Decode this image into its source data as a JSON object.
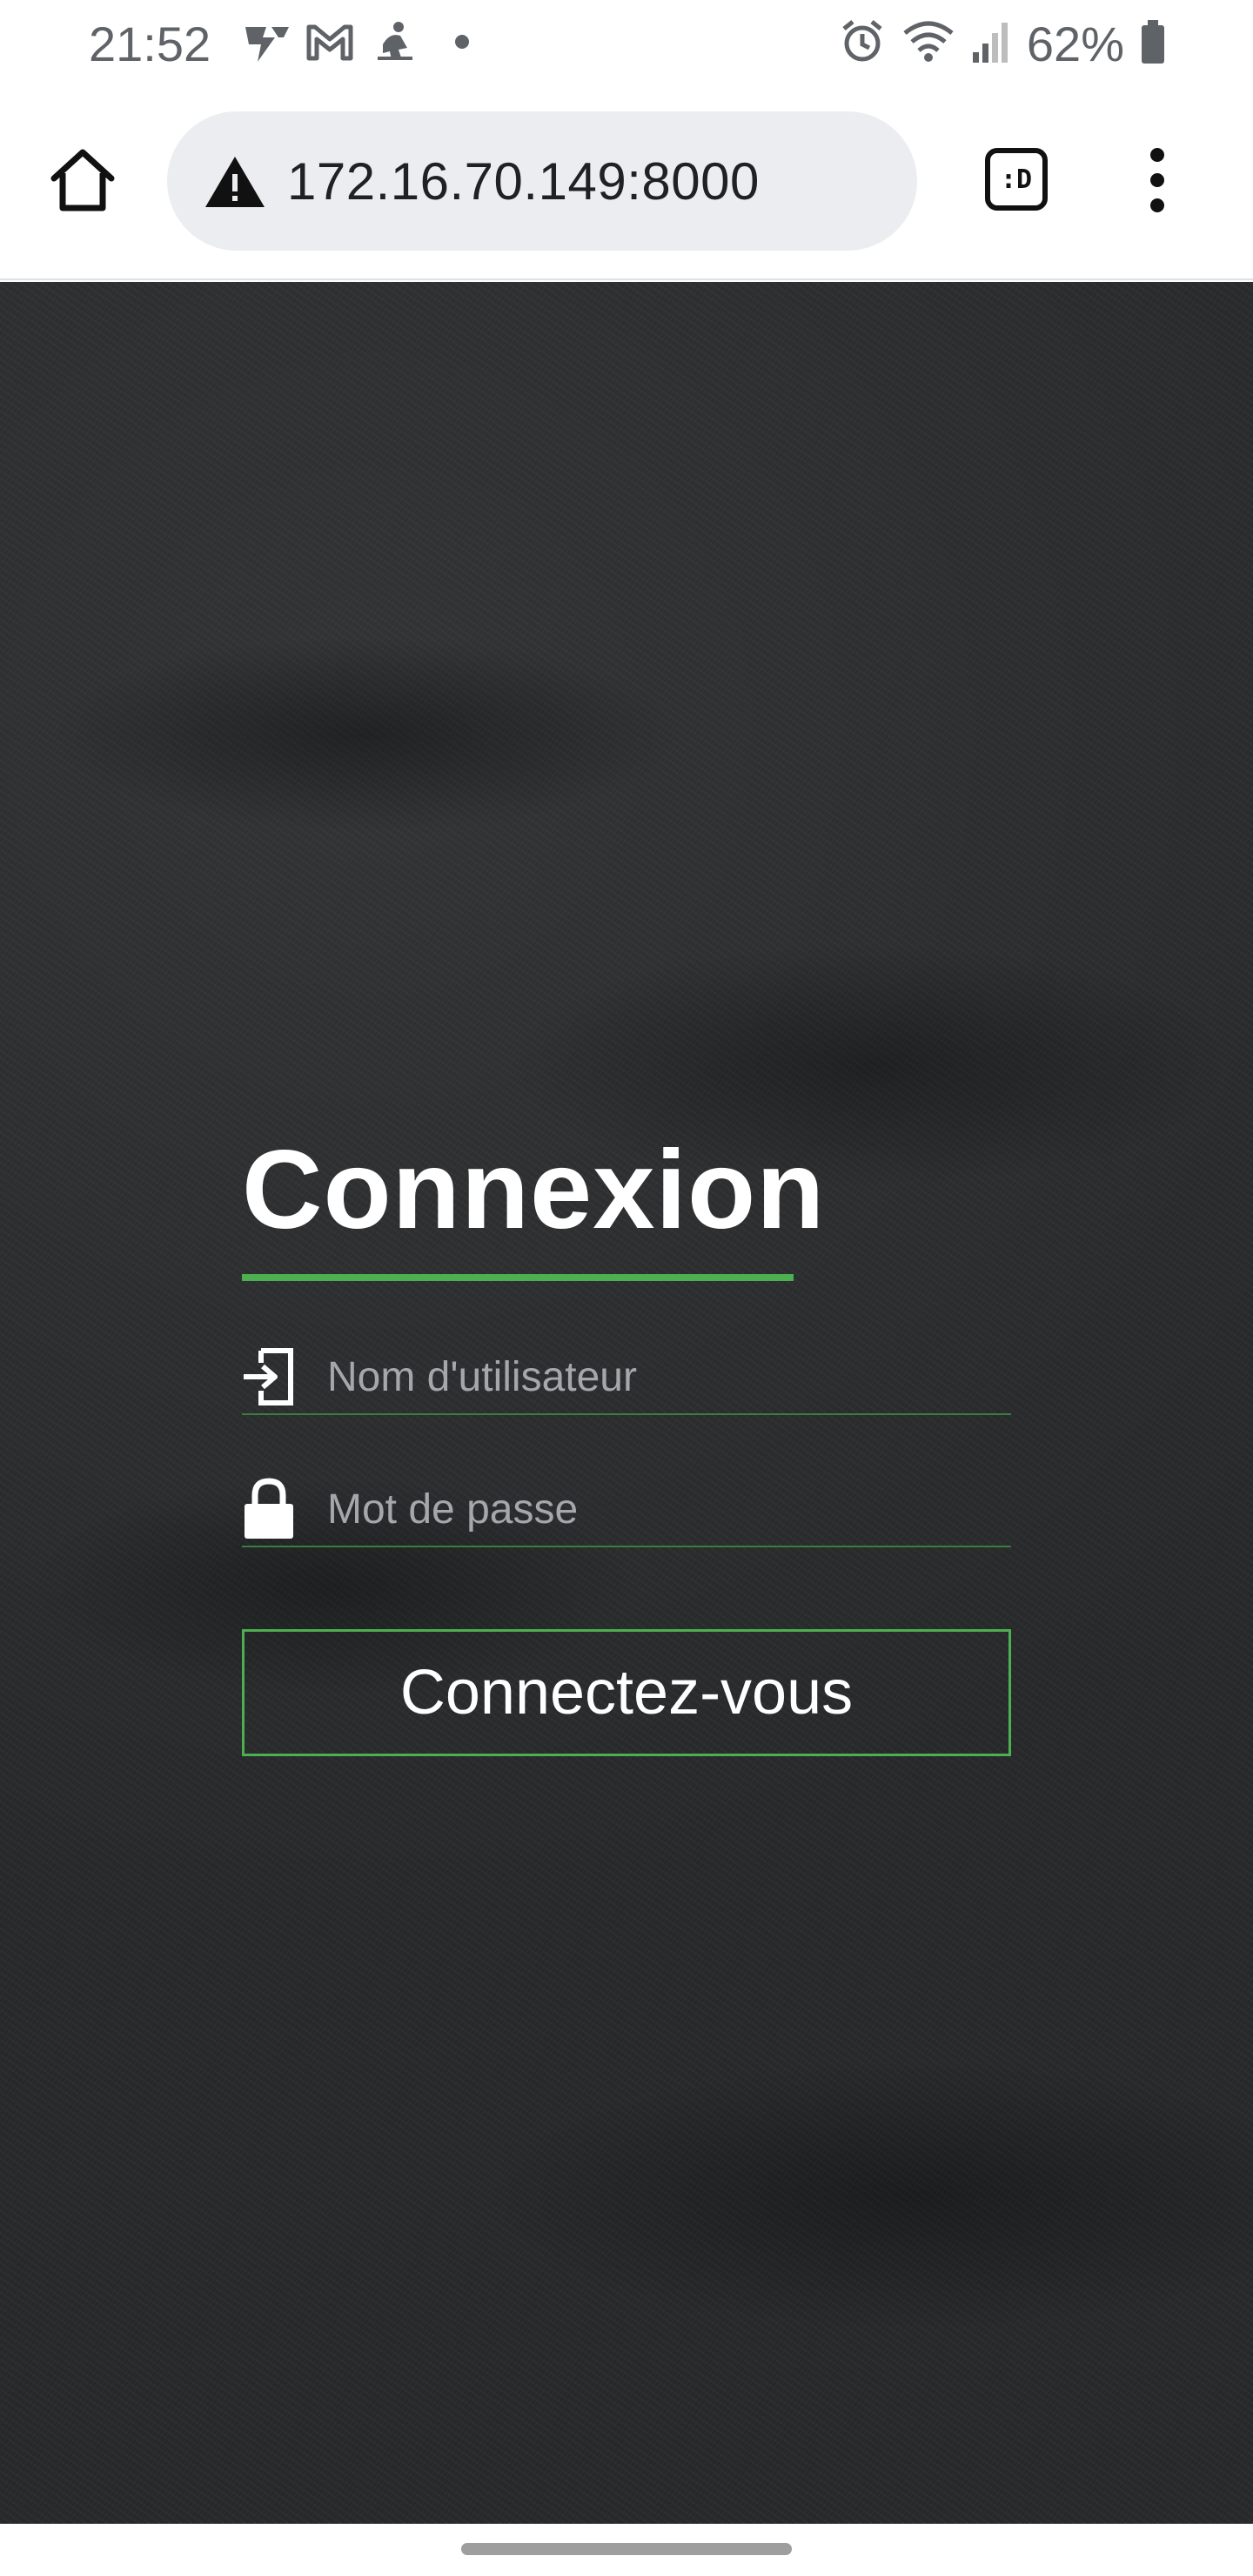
{
  "status_bar": {
    "time": "21:52",
    "battery": "62%",
    "icons": [
      "flash-app-icon",
      "gmail-icon",
      "fitness-icon",
      "dot-icon",
      "alarm-icon",
      "wifi-icon",
      "signal-icon",
      "battery-icon"
    ]
  },
  "browser": {
    "url": "172.16.70.149:8000",
    "tab_label": ":D",
    "icons": [
      "home-icon",
      "warning-icon",
      "tab-switcher-icon",
      "more-vert-icon"
    ]
  },
  "login": {
    "title": "Connexion",
    "username_placeholder": "Nom d'utilisateur",
    "password_placeholder": "Mot de passe",
    "submit_label": "Connectez-vous"
  },
  "colors": {
    "accent": "#4caf50",
    "page_background": "#26282a",
    "placeholder": "#a5a7aa"
  }
}
